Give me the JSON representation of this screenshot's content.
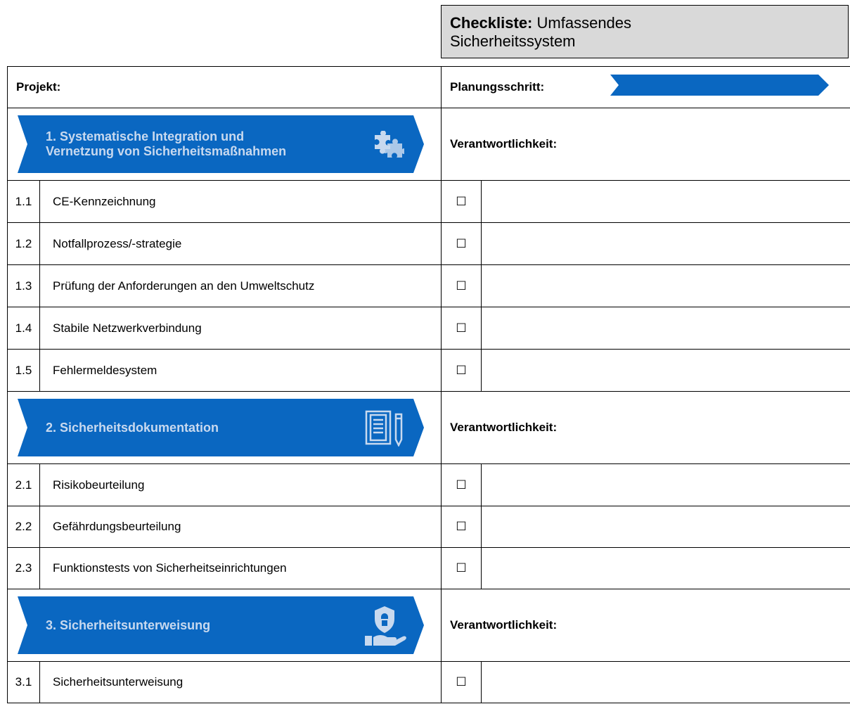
{
  "title": {
    "bold": "Checkliste:",
    "rest_line1": "Umfassendes",
    "rest_line2": "Sicherheitssystem"
  },
  "header": {
    "projekt_label": "Projekt:",
    "planung_label": "Planungsschritt:"
  },
  "responsibility_label": "Verantwortlichkeit:",
  "checkbox_glyph": "☐",
  "colors": {
    "banner_blue": "#0a67c1",
    "title_bg": "#d9d9d9",
    "banner_text": "#c8d9ef"
  },
  "sections": [
    {
      "title_line1": "1. Systematische Integration und",
      "title_line2": "Vernetzung von Sicherheitsmaßnahmen",
      "icon": "puzzle-icon",
      "items": [
        {
          "num": "1.1",
          "text": "CE-Kennzeichnung"
        },
        {
          "num": "1.2",
          "text": "Notfallprozess/-strategie"
        },
        {
          "num": "1.3",
          "text": "Prüfung der Anforderungen an den Umweltschutz"
        },
        {
          "num": "1.4",
          "text": "Stabile Netzwerkverbindung"
        },
        {
          "num": "1.5",
          "text": "Fehlermeldesystem"
        }
      ]
    },
    {
      "title_line1": "2. Sicherheitsdokumentation",
      "title_line2": "",
      "icon": "document-pen-icon",
      "items": [
        {
          "num": "2.1",
          "text": "Risikobeurteilung"
        },
        {
          "num": "2.2",
          "text": "Gefährdungsbeurteilung"
        },
        {
          "num": "2.3",
          "text": "Funktionstests von Sicherheitseinrichtungen"
        }
      ]
    },
    {
      "title_line1": "3. Sicherheitsunterweisung",
      "title_line2": "",
      "icon": "shield-hand-icon",
      "items": [
        {
          "num": "3.1",
          "text": "Sicherheitsunterweisung"
        }
      ]
    }
  ]
}
